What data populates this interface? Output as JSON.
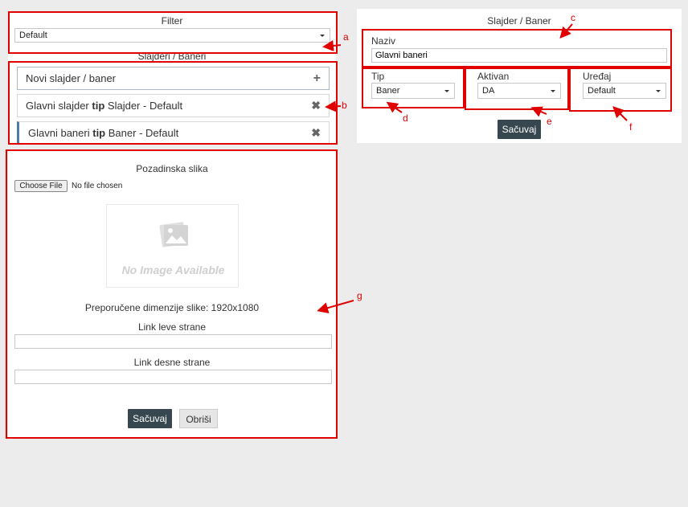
{
  "filter": {
    "title": "Filter",
    "selected": "Default"
  },
  "list_section": {
    "title": "Slajderi / Baneri",
    "new_item": "Novi slajder / baner",
    "items": [
      {
        "name": "Glavni slajder",
        "tip_word": "tip",
        "tip_value": "Slajder",
        "device": "Default"
      },
      {
        "name": "Glavni baneri",
        "tip_word": "tip",
        "tip_value": "Baner",
        "device": "Default"
      }
    ]
  },
  "image_section": {
    "title": "Pozadinska slika",
    "choose_file": "Choose File",
    "no_file": "No file chosen",
    "placeholder_text": "No Image Available",
    "recommended": "Preporučene dimenzije slike: 1920x1080",
    "link_left_label": "Link leve strane",
    "link_left_value": "",
    "link_right_label": "Link desne strane",
    "link_right_value": "",
    "save": "Sačuvaj",
    "delete": "Obriši"
  },
  "form": {
    "title": "Slajder / Baner",
    "naziv_label": "Naziv",
    "naziv_value": "Glavni baneri",
    "tip_label": "Tip",
    "tip_value": "Baner",
    "aktivan_label": "Aktivan",
    "aktivan_value": "DA",
    "uredjaj_label": "Uređaj",
    "uredjaj_value": "Default",
    "save": "Sačuvaj"
  },
  "annotations": {
    "a": "a",
    "b": "b",
    "c": "c",
    "d": "d",
    "e": "e",
    "f": "f",
    "g": "g"
  },
  "colors": {
    "annotation": "#e00000",
    "dark_button": "#37474f",
    "active_accent": "#4f7aa8"
  },
  "icons": {
    "add": "plus-icon",
    "remove": "close-icon",
    "image": "image-placeholder-icon",
    "dropdown": "chevron-down-icon"
  }
}
